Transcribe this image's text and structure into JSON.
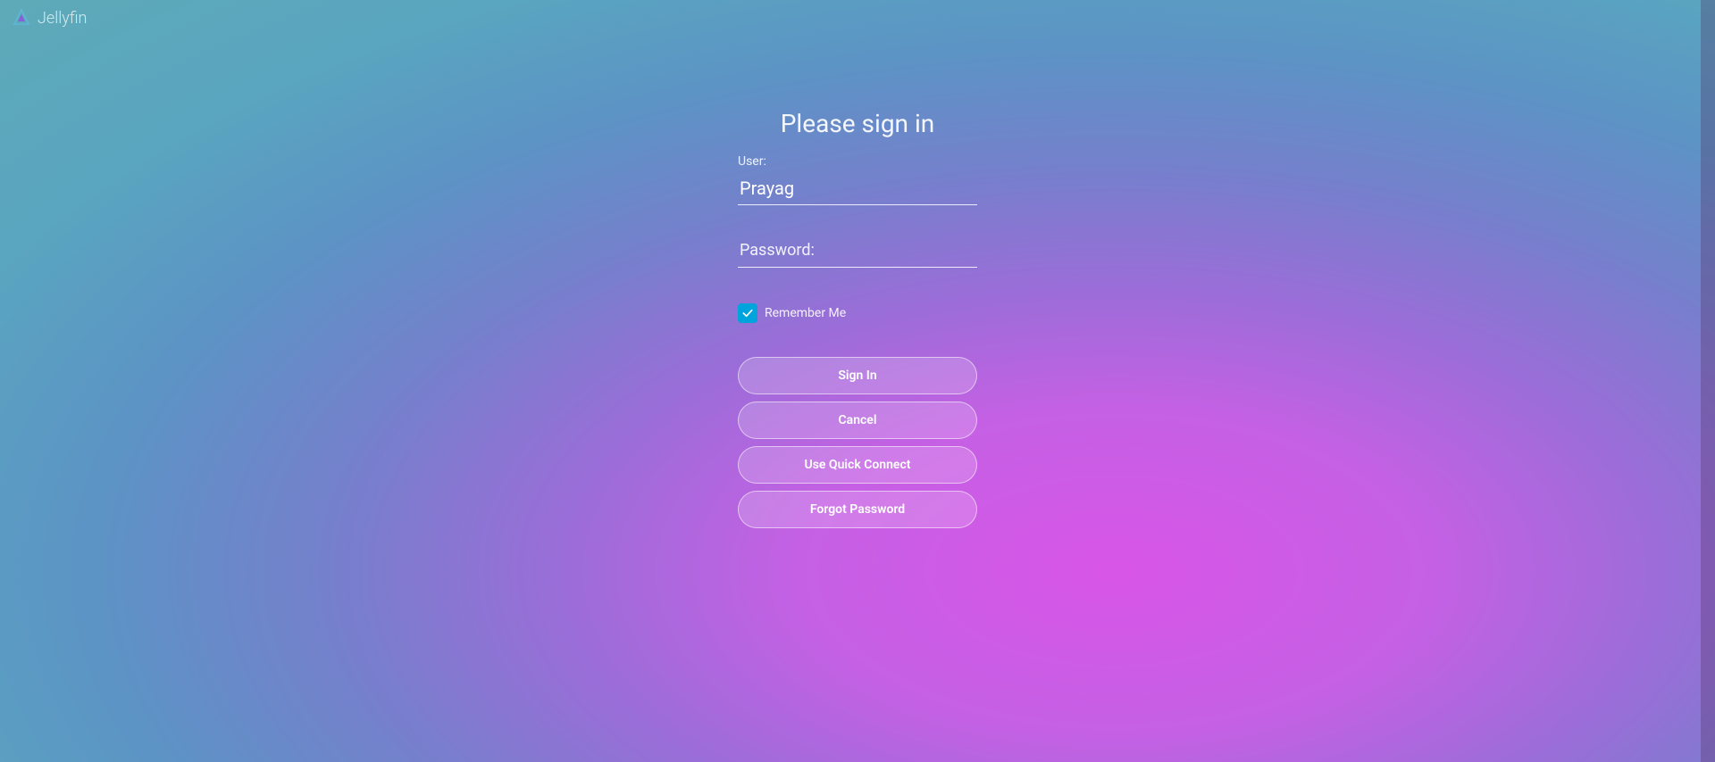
{
  "header": {
    "brand": "Jellyfin"
  },
  "login": {
    "title": "Please sign in",
    "user_label": "User:",
    "user_value": "Prayag",
    "password_label": "Password:",
    "password_value": "",
    "remember_label": "Remember Me",
    "remember_checked": true,
    "buttons": {
      "signin": "Sign In",
      "cancel": "Cancel",
      "quick_connect": "Use Quick Connect",
      "forgot": "Forgot Password"
    }
  }
}
